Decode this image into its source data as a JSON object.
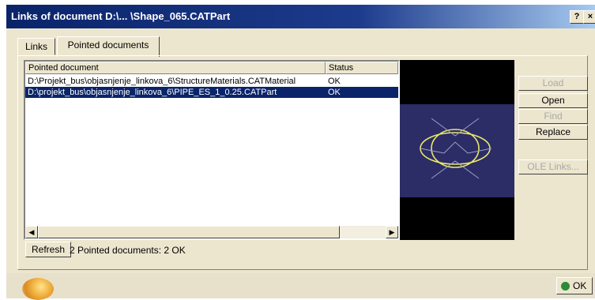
{
  "window": {
    "title": "Links of document D:\\... \\Shape_065.CATPart",
    "help_glyph": "?",
    "close_glyph": "×"
  },
  "tabs": [
    {
      "label": "Links"
    },
    {
      "label": "Pointed documents"
    }
  ],
  "table": {
    "columns": [
      "Pointed document",
      "Status"
    ],
    "rows": [
      {
        "document": "D:\\Projekt_bus\\objasnjenje_linkova_6\\StructureMaterials.CATMaterial",
        "status": "OK",
        "selected": false
      },
      {
        "document": "D:\\projekt_bus\\objasnjenje_linkova_6\\PIPE_ES_1_0.25.CATPart",
        "status": "OK",
        "selected": true
      }
    ]
  },
  "scrollbar": {
    "left_glyph": "◀",
    "right_glyph": "▶"
  },
  "buttons": {
    "load": {
      "label": "Load",
      "enabled": false
    },
    "open": {
      "label": "Open",
      "enabled": true
    },
    "find": {
      "label": "Find",
      "enabled": false
    },
    "replace": {
      "label": "Replace",
      "enabled": true
    },
    "ole_links": {
      "label": "OLE Links...",
      "enabled": false
    }
  },
  "refresh_label": "Refresh",
  "status_text": "2 Pointed documents: 2 OK",
  "ok_label": "OK",
  "colors": {
    "title_bar": "#0a246a",
    "selection": "#0a246a",
    "preview_bg": "#000000",
    "viewport_bg": "#2c2c66",
    "geometry": "#e8e86a",
    "dialog_face": "#ece6cf"
  }
}
